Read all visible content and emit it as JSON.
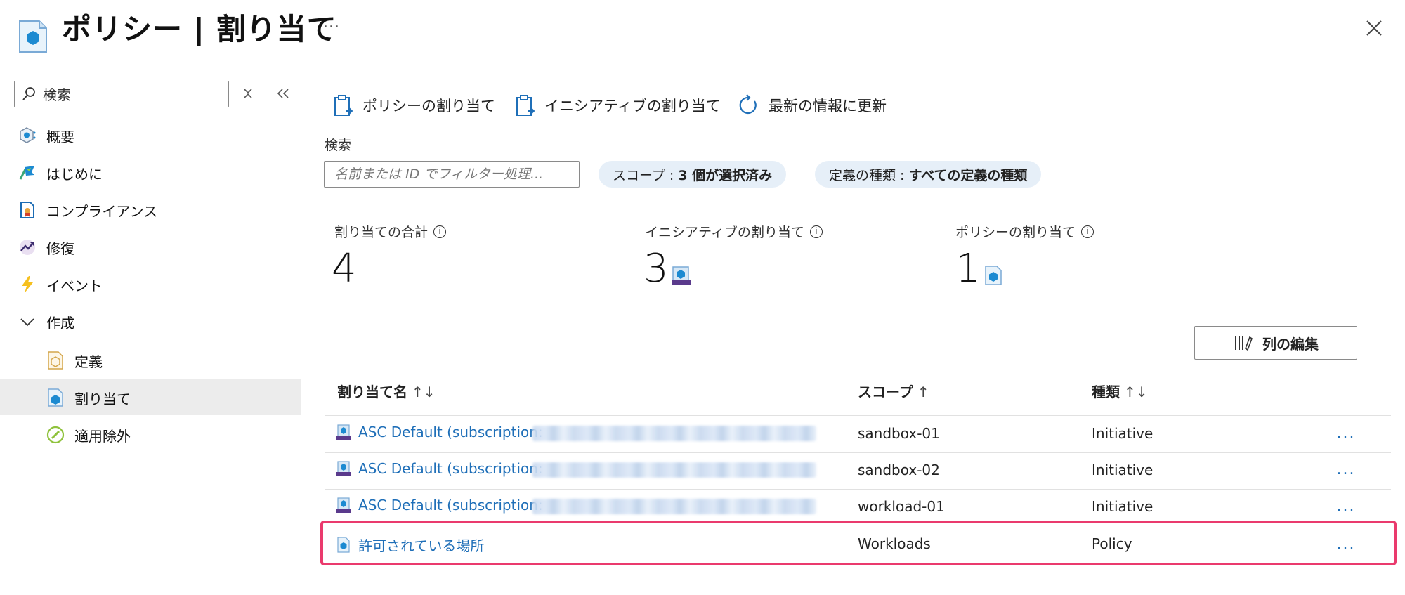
{
  "header": {
    "title": "ポリシー | 割り当て",
    "more": "...",
    "close_label": "×"
  },
  "sidebar": {
    "search_placeholder": "検索",
    "items": [
      {
        "label": "概要",
        "icon": "overview-icon"
      },
      {
        "label": "はじめに",
        "icon": "getting-started-icon"
      },
      {
        "label": "コンプライアンス",
        "icon": "compliance-icon"
      },
      {
        "label": "修復",
        "icon": "remediation-icon"
      },
      {
        "label": "イベント",
        "icon": "events-icon"
      },
      {
        "label": "作成",
        "icon": "chevron-down-icon"
      },
      {
        "label": "定義",
        "icon": "definitions-icon"
      },
      {
        "label": "割り当て",
        "icon": "assignments-icon",
        "selected": true
      },
      {
        "label": "適用除外",
        "icon": "exemptions-icon"
      }
    ]
  },
  "toolbar": {
    "assign_policy": "ポリシーの割り当て",
    "assign_initiative": "イニシアティブの割り当て",
    "refresh": "最新の情報に更新"
  },
  "filter": {
    "label": "検索",
    "placeholder": "名前または ID でフィルター処理...",
    "scope_label": "スコープ :",
    "scope_value": "3 個が選択済み",
    "type_label": "定義の種類 :",
    "type_value": "すべての定義の種類"
  },
  "stats": {
    "total_label": "割り当ての合計",
    "total_value": "4",
    "initiative_label": "イニシアティブの割り当て",
    "initiative_value": "3",
    "policy_label": "ポリシーの割り当て",
    "policy_value": "1"
  },
  "edit_columns": "列の編集",
  "table": {
    "headers": {
      "name": "割り当て名",
      "scope": "スコープ",
      "type": "種類"
    },
    "sort_icons": {
      "name": "↑↓",
      "scope": "↑",
      "type": "↑↓"
    },
    "rows": [
      {
        "name": "ASC Default (subscription:",
        "scope": "sandbox-01",
        "type": "Initiative",
        "more": "..."
      },
      {
        "name": "ASC Default (subscription:",
        "scope": "sandbox-02",
        "type": "Initiative",
        "more": "..."
      },
      {
        "name": "ASC Default (subscription:",
        "scope": "workload-01",
        "type": "Initiative",
        "more": "..."
      },
      {
        "name": "許可されている場所",
        "scope": "Workloads",
        "type": "Policy",
        "more": "..."
      }
    ]
  },
  "colors": {
    "accent": "#1f6fb8",
    "highlight": "#ea3a6d",
    "selected_bg": "#ececec",
    "pill_bg": "#e6eff8"
  }
}
